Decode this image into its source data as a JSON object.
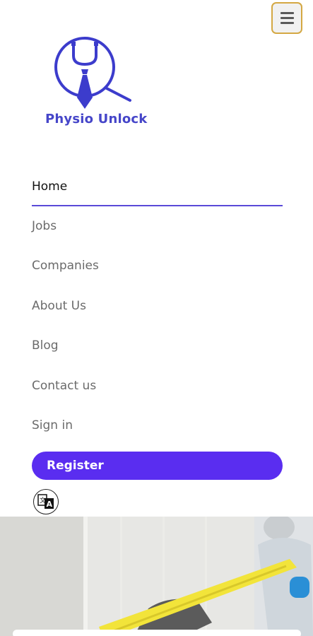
{
  "brand": {
    "name": "Physio Unlock",
    "color": "#4646c9"
  },
  "nav": {
    "items": [
      {
        "label": "Home",
        "active": true
      },
      {
        "label": "Jobs"
      },
      {
        "label": "Companies"
      },
      {
        "label": "About Us"
      },
      {
        "label": "Blog"
      },
      {
        "label": "Contact us"
      },
      {
        "label": "Sign in"
      }
    ]
  },
  "register": {
    "label": "Register",
    "color": "#5a2df0"
  },
  "icons": {
    "menu": "hamburger-menu-icon",
    "translate": "translate-icon"
  },
  "colors": {
    "accent": "#5a4ad8",
    "toggle_border": "#d4a843"
  }
}
